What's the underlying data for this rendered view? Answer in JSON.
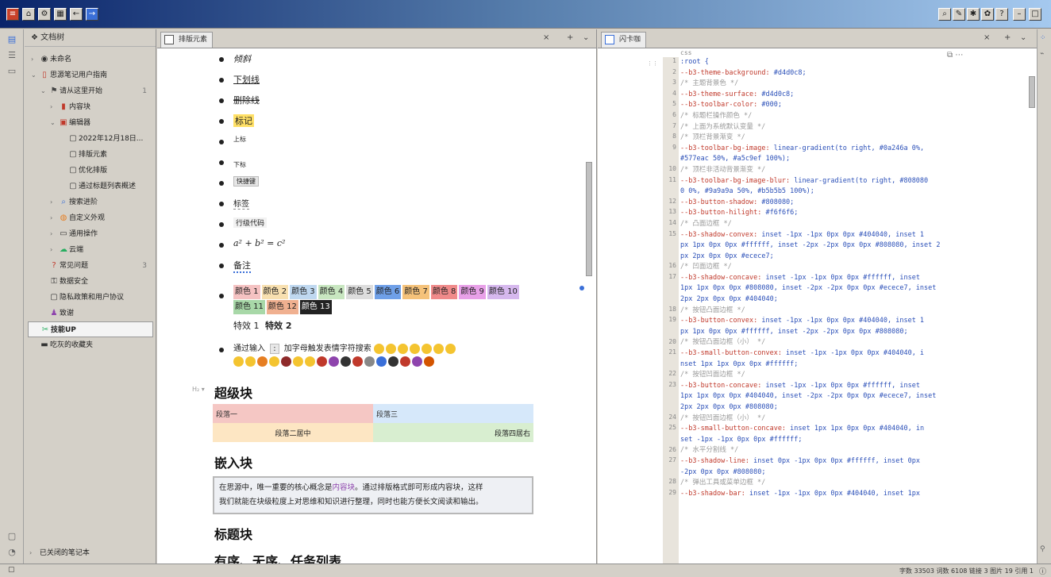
{
  "titlebar": {
    "left_buttons": [
      "menu",
      "home",
      "settings",
      "calendar",
      "back",
      "forward"
    ],
    "right_buttons": [
      "search",
      "edit",
      "sync",
      "bookmark",
      "help",
      "minimize",
      "maximize"
    ]
  },
  "filetree": {
    "header": "文档树",
    "items": [
      {
        "label": "未命名",
        "icon": "globe-icon",
        "level": 0,
        "expanded": false
      },
      {
        "label": "思源笔记用户指南",
        "icon": "book-icon",
        "level": 0,
        "expanded": true
      },
      {
        "label": "请从这里开始",
        "icon": "flag-icon",
        "level": 1,
        "expanded": true,
        "count": "1"
      },
      {
        "label": "内容块",
        "icon": "block-icon",
        "level": 2,
        "expanded": false
      },
      {
        "label": "编辑器",
        "icon": "editor-icon",
        "level": 2,
        "expanded": true
      },
      {
        "label": "2022年12月18日...",
        "icon": "doc-icon",
        "level": 3
      },
      {
        "label": "排版元素",
        "icon": "doc-icon",
        "level": 3
      },
      {
        "label": "优化排版",
        "icon": "doc-icon",
        "level": 3
      },
      {
        "label": "通过标题列表概述",
        "icon": "doc-icon",
        "level": 3
      },
      {
        "label": "搜索进阶",
        "icon": "search-icon",
        "level": 2,
        "expanded": false
      },
      {
        "label": "自定义外观",
        "icon": "palette-icon",
        "level": 2,
        "expanded": false
      },
      {
        "label": "通用操作",
        "icon": "tools-icon",
        "level": 2,
        "expanded": false
      },
      {
        "label": "云端",
        "icon": "cloud-icon",
        "level": 2,
        "expanded": false
      },
      {
        "label": "常见问题",
        "icon": "question-icon",
        "level": 1,
        "count": "3"
      },
      {
        "label": "数据安全",
        "icon": "lock-icon",
        "level": 1
      },
      {
        "label": "隐私政策和用户协议",
        "icon": "doc-icon",
        "level": 1
      },
      {
        "label": "致谢",
        "icon": "people-icon",
        "level": 1
      },
      {
        "label": "技能UP",
        "icon": "skill-icon",
        "level": 0,
        "selected": true
      },
      {
        "label": "吃灰的收藏夹",
        "icon": "folder-icon",
        "level": 0
      }
    ],
    "footer": "已关闭的笔记本"
  },
  "editor1": {
    "tab_label": "排版元素",
    "bullets": [
      {
        "text": "倾斜",
        "style": "italic"
      },
      {
        "text": "下划线",
        "style": "underline"
      },
      {
        "text": "删除线",
        "style": "strike"
      },
      {
        "text": "标记",
        "style": "mark"
      },
      {
        "text": "上标",
        "style": "sup"
      },
      {
        "text": "下标",
        "style": "sub"
      },
      {
        "text": "快捷键",
        "style": "kbd"
      },
      {
        "text": "标签",
        "style": "tag"
      },
      {
        "text": "行级代码",
        "style": "code"
      },
      {
        "text": "a² + b² = c²",
        "style": "math"
      },
      {
        "text": "备注",
        "style": "memo"
      }
    ],
    "color_chips": [
      {
        "label": "颜色 1",
        "bg": "#f5c2c2"
      },
      {
        "label": "颜色 2",
        "bg": "#f8e0b0"
      },
      {
        "label": "颜色 3",
        "bg": "#bfd8f0"
      },
      {
        "label": "颜色 4",
        "bg": "#c8e6c0"
      },
      {
        "label": "颜色 5",
        "bg": "#dddddd"
      },
      {
        "label": "颜色 6",
        "bg": "#6fa0e8"
      },
      {
        "label": "颜色 7",
        "bg": "#f5c27a"
      },
      {
        "label": "颜色 8",
        "bg": "#f08a8a"
      },
      {
        "label": "颜色 9",
        "bg": "#e8a0e8"
      },
      {
        "label": "颜色 10",
        "bg": "#d6b8ee"
      },
      {
        "label": "颜色 11",
        "bg": "#a8d8a8"
      },
      {
        "label": "颜色 12",
        "bg": "#f0b090"
      },
      {
        "label": "颜色 13",
        "bg": "#222222"
      }
    ],
    "effects": [
      "特效 1",
      "特效 2"
    ],
    "emoji_prefix": "通过输入",
    "emoji_kbd": ":",
    "emoji_text": "加字母触发表情字符搜索",
    "h_super": "超级块",
    "super_cells": {
      "p1": "段落一",
      "p3": "段落三",
      "p2": "段落二居中",
      "p4": "段落四居右"
    },
    "h_embed": "嵌入块",
    "embed_text_1": "在思源中，唯一重要的核心概念是",
    "embed_link": "内容块",
    "embed_text_2": "。通过排版格式即可形成内容块，这样",
    "embed_text_3": "我们就能在块级粒度上对思维和知识进行整理，同时也能方便长文阅读和输出。",
    "h_title": "标题块",
    "h_list": "有序、无序、任务列表"
  },
  "editor2": {
    "tab_label": "闪卡咖",
    "lang": "css",
    "lines": [
      {
        "n": "1",
        "t": ":root {",
        "c": false
      },
      {
        "n": "2",
        "t": "    --b3-theme-background: #d4d0c8;",
        "c": false
      },
      {
        "n": "3",
        "t": "    /* 主题背景色 */",
        "c": true
      },
      {
        "n": "4",
        "t": "    --b3-theme-surface: #d4d0c8;",
        "c": false
      },
      {
        "n": "5",
        "t": "    --b3-toolbar-color: #000;",
        "c": false
      },
      {
        "n": "6",
        "t": "    /* 标题栏操作颜色 */",
        "c": true
      },
      {
        "n": "7",
        "t": "    /* 上面为系统默认变量 */",
        "c": true
      },
      {
        "n": "8",
        "t": "    /* 顶栏背景渐变 */",
        "c": true
      },
      {
        "n": "9",
        "t": "    --b3-toolbar-bg-image: linear-gradient(to right, #0a246a 0%,",
        "c": false
      },
      {
        "n": "",
        "t": "#577eac 50%, #a5c9ef 100%);",
        "c": false
      },
      {
        "n": "10",
        "t": "    /* 顶栏非活动背景渐变 */",
        "c": true
      },
      {
        "n": "11",
        "t": "    --b3-toolbar-bg-image-blur: linear-gradient(to right, #808080",
        "c": false
      },
      {
        "n": "",
        "t": "0 0%, #9a9a9a 50%, #b5b5b5 100%);",
        "c": false
      },
      {
        "n": "12",
        "t": "    --b3-button-shadow: #808080;",
        "c": false
      },
      {
        "n": "13",
        "t": "    --b3-button-hilight: #f6f6f6;",
        "c": false
      },
      {
        "n": "14",
        "t": "    /* 凸面边框 */",
        "c": true
      },
      {
        "n": "15",
        "t": "    --b3-shadow-convex: inset -1px -1px 0px 0px #404040, inset 1",
        "c": false
      },
      {
        "n": "",
        "t": "px 1px 0px 0px #ffffff, inset -2px -2px 0px 0px #808080, inset 2",
        "c": false
      },
      {
        "n": "",
        "t": "px 2px 0px 0px #ecece7;",
        "c": false
      },
      {
        "n": "16",
        "t": "    /* 凹面边框 */",
        "c": true
      },
      {
        "n": "17",
        "t": "    --b3-shadow-concave: inset -1px -1px 0px 0px #ffffff, inset",
        "c": false
      },
      {
        "n": "",
        "t": "1px 1px 0px 0px #808080, inset -2px -2px 0px 0px #ecece7, inset",
        "c": false
      },
      {
        "n": "",
        "t": "2px 2px 0px 0px #404040;",
        "c": false
      },
      {
        "n": "18",
        "t": "    /* 按钮凸面边框 */",
        "c": true
      },
      {
        "n": "19",
        "t": "    --b3-button-convex: inset -1px -1px 0px 0px #404040, inset 1",
        "c": false
      },
      {
        "n": "",
        "t": "px 1px 0px 0px #ffffff, inset -2px -2px 0px 0px #808080;",
        "c": false
      },
      {
        "n": "20",
        "t": "    /* 按钮凸面边框（小） */",
        "c": true
      },
      {
        "n": "21",
        "t": "    --b3-small-button-convex: inset -1px -1px 0px 0px #404040, i",
        "c": false
      },
      {
        "n": "",
        "t": "nset 1px 1px 0px 0px #ffffff;",
        "c": false
      },
      {
        "n": "22",
        "t": "    /* 按钮凹面边框 */",
        "c": true
      },
      {
        "n": "23",
        "t": "    --b3-button-concave: inset -1px -1px 0px 0px #ffffff, inset",
        "c": false
      },
      {
        "n": "",
        "t": "1px 1px 0px 0px #404040, inset -2px -2px 0px 0px #ecece7, inset",
        "c": false
      },
      {
        "n": "",
        "t": "2px 2px 0px 0px #808080;",
        "c": false
      },
      {
        "n": "24",
        "t": "    /* 按钮凹面边框（小） */",
        "c": true
      },
      {
        "n": "25",
        "t": "    --b3-small-button-concave: inset 1px 1px 0px 0px #404040, in",
        "c": false
      },
      {
        "n": "",
        "t": "set -1px -1px 0px 0px #ffffff;",
        "c": false
      },
      {
        "n": "26",
        "t": "    /* 水平分割线 */",
        "c": true
      },
      {
        "n": "27",
        "t": "    --b3-shadow-line: inset 0px -1px 0px 0px #ffffff, inset 0px",
        "c": false
      },
      {
        "n": "",
        "t": "-2px 0px 0px #808080;",
        "c": false
      },
      {
        "n": "28",
        "t": "    /* 弹出工具或菜单边框 */",
        "c": true
      },
      {
        "n": "29",
        "t": "    --b3-shadow-bar: inset -1px -1px 0px 0px #404040, inset 1px",
        "c": false
      }
    ]
  },
  "statusbar": {
    "text": "字数 33503  词数 6108  链接 3  图片 19  引用 1"
  }
}
